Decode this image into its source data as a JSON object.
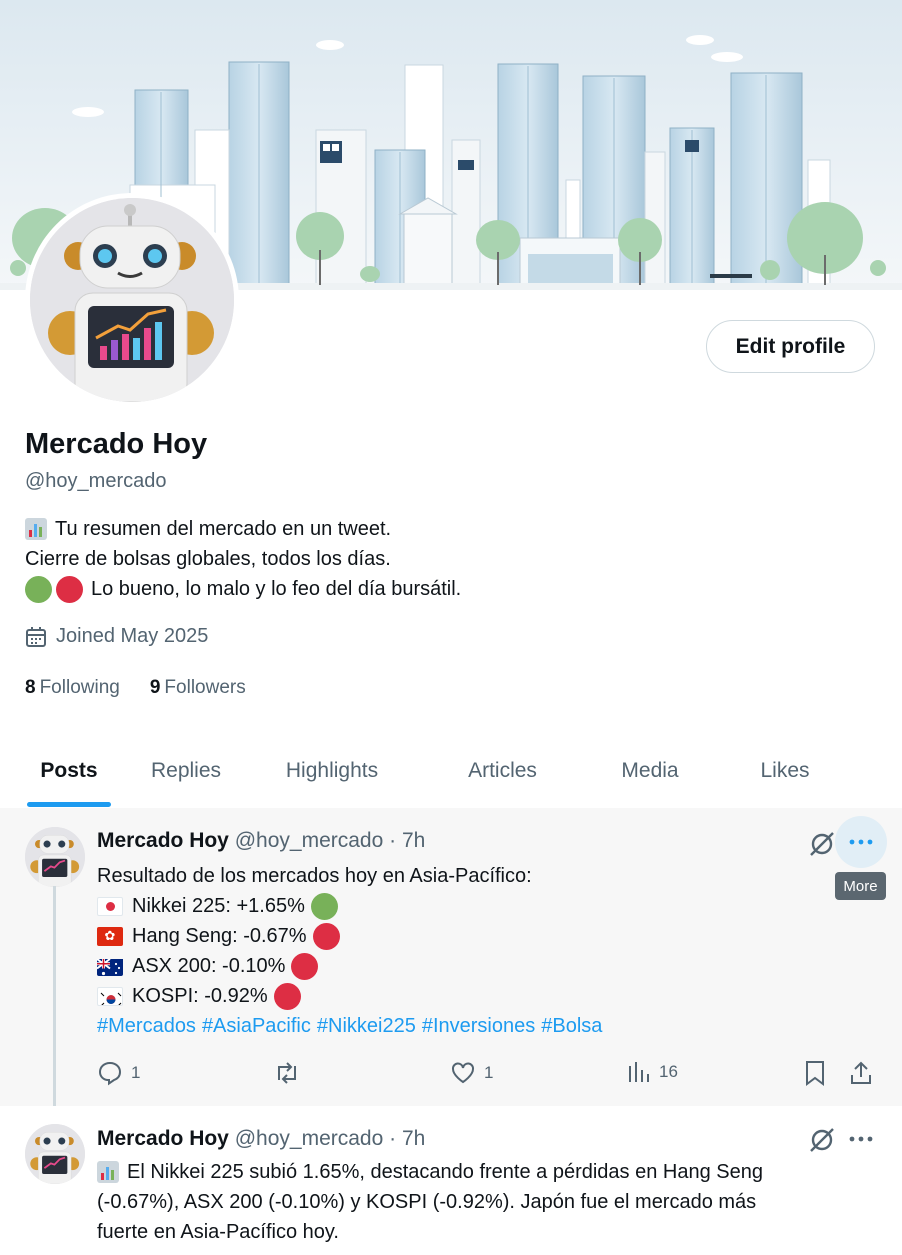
{
  "profile": {
    "name": "Mercado Hoy",
    "handle": "@hoy_mercado",
    "edit_profile_label": "Edit profile",
    "bio": {
      "line1": "Tu resumen del mercado en un tweet.",
      "line2": "Cierre de bolsas globales, todos los días.",
      "line3": "Lo bueno, lo malo y lo feo del día bursátil."
    },
    "joined": "Joined May 2025",
    "following_count": "8",
    "following_label": "Following",
    "followers_count": "9",
    "followers_label": "Followers"
  },
  "tabs": [
    {
      "label": "Posts",
      "active": true
    },
    {
      "label": "Replies"
    },
    {
      "label": "Highlights"
    },
    {
      "label": "Articles"
    },
    {
      "label": "Media"
    },
    {
      "label": "Likes"
    }
  ],
  "posts": [
    {
      "author": "Mercado Hoy",
      "meta": "@hoy_mercado · 7h",
      "intro": "Resultado de los mercados hoy en Asia-Pacífico:",
      "lines": [
        {
          "flag": "japan-flag",
          "text": "Nikkei 225: +1.65%",
          "status": "green"
        },
        {
          "flag": "hong-kong-flag",
          "text": "Hang Seng: -0.67%",
          "status": "red"
        },
        {
          "flag": "australia-flag",
          "text": "ASX 200: -0.10%",
          "status": "red"
        },
        {
          "flag": "south-korea-flag",
          "text": "KOSPI: -0.92%",
          "status": "red"
        }
      ],
      "hashtags": [
        "#Mercados",
        "#AsiaPacific",
        "#Nikkei225",
        "#Inversiones",
        "#Bolsa"
      ],
      "replies": "1",
      "reposts": "",
      "likes": "1",
      "views": "16",
      "tooltip": "More"
    },
    {
      "author": "Mercado Hoy",
      "meta": "@hoy_mercado · 7h",
      "line1": "El Nikkei 225 subió 1.65%, destacando frente a pérdidas en Hang Seng",
      "line2": "(-0.67%), ASX 200 (-0.10%) y KOSPI (-0.92%). Japón fue el mercado más",
      "line3": "fuerte en Asia-Pacífico hoy."
    }
  ],
  "colors": {
    "accent": "#1d9bf0",
    "text_primary": "#0f1419",
    "text_secondary": "#536471",
    "positive": "#78b159",
    "negative": "#dd2e44"
  }
}
